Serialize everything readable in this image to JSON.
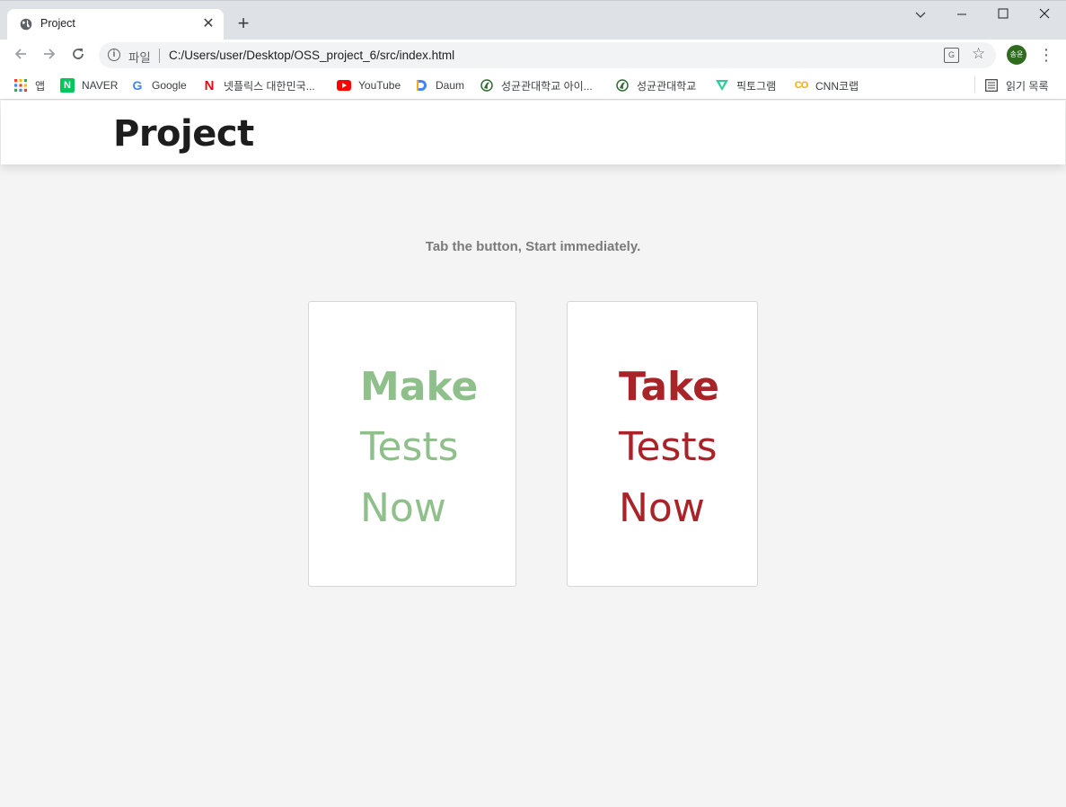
{
  "browser": {
    "tab_title": "Project",
    "new_tab": "+",
    "close_tab": "✕",
    "scheme_label": "파일",
    "url": "C:/Users/user/Desktop/OSS_project_6/src/index.html",
    "profile_initials": "송윤",
    "window_controls": {
      "dropdown": "⌄",
      "minimize": "—",
      "maximize": "☐",
      "close": "✕"
    },
    "bookmarks": [
      {
        "label": "앱",
        "icon": "apps-grid-icon"
      },
      {
        "label": "NAVER",
        "icon": "naver-icon"
      },
      {
        "label": "Google",
        "icon": "google-icon"
      },
      {
        "label": "넷플릭스 대한민국...",
        "icon": "netflix-icon"
      },
      {
        "label": "YouTube",
        "icon": "youtube-icon"
      },
      {
        "label": "Daum",
        "icon": "daum-icon"
      },
      {
        "label": "성균관대학교 아이...",
        "icon": "skku-icon"
      },
      {
        "label": "성균관대학교",
        "icon": "skku-icon"
      },
      {
        "label": "픽토그램",
        "icon": "pictogram-icon"
      },
      {
        "label": "CNN코랩",
        "icon": "colab-icon"
      }
    ],
    "reading_list": "읽기 목록"
  },
  "page": {
    "title": "Project",
    "subtitle": "Tab the button, Start immediately.",
    "make_card": {
      "line1": "Make",
      "line2": "Tests",
      "line3": "Now",
      "color": "#8fbf8a"
    },
    "take_card": {
      "line1": "Take",
      "line2": "Tests",
      "line3": "Now",
      "color": "#a82428"
    }
  }
}
